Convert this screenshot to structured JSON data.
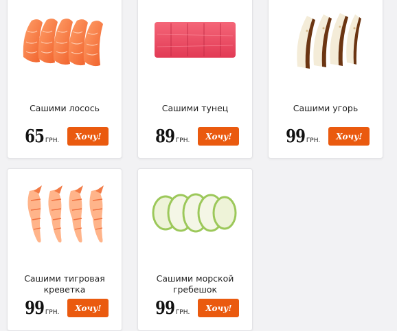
{
  "products": [
    {
      "name": "Сашими лосось",
      "price": "65",
      "currency": "ГРН.",
      "button": "Хочу!",
      "image": "salmon-sashimi"
    },
    {
      "name": "Сашими тунец",
      "price": "89",
      "currency": "ГРН.",
      "button": "Хочу!",
      "image": "tuna-sashimi"
    },
    {
      "name": "Сашими угорь",
      "price": "99",
      "currency": "ГРН.",
      "button": "Хочу!",
      "image": "eel-sashimi"
    },
    {
      "name": "Сашими тигровая креветка",
      "price": "99",
      "currency": "ГРН.",
      "button": "Хочу!",
      "image": "tiger-shrimp-sashimi"
    },
    {
      "name": "Сашими морской гребешок",
      "price": "99",
      "currency": "ГРН.",
      "button": "Хочу!",
      "image": "scallop-sashimi"
    }
  ],
  "colors": {
    "button": "#ea5a0f",
    "card": "#ffffff",
    "background": "#f2f2f4"
  }
}
